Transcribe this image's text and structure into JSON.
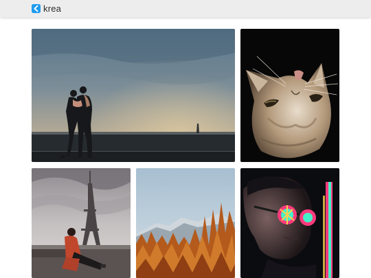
{
  "app": {
    "brand": "krea",
    "accent": "#1e9bf0"
  },
  "gallery": {
    "tiles": [
      {
        "id": "couple",
        "kind": "photo"
      },
      {
        "id": "cat",
        "kind": "photo"
      },
      {
        "id": "eiffel",
        "kind": "photo"
      },
      {
        "id": "forest",
        "kind": "photo"
      },
      {
        "id": "neon",
        "kind": "photo"
      }
    ]
  }
}
